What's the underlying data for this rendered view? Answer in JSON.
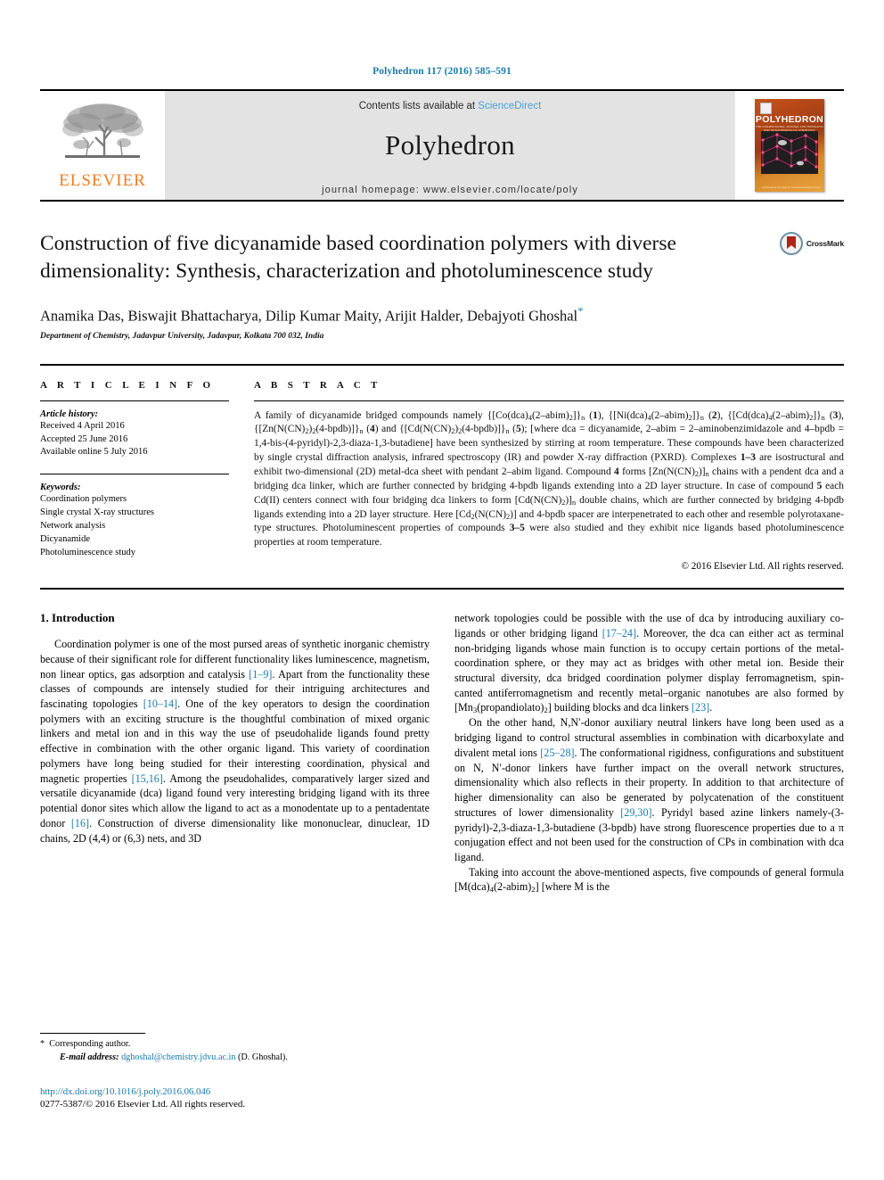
{
  "running_head": "Polyhedron 117 (2016) 585–591",
  "masthead": {
    "contents_prefix": "Contents lists available at ",
    "sciencedirect": "ScienceDirect",
    "journal_name": "Polyhedron",
    "homepage": "journal homepage: www.elsevier.com/locate/poly",
    "publisher_logo_text": "ELSEVIER",
    "cover": {
      "title": "POLYHEDRON",
      "subtitle": "THE INTERNATIONAL JOURNAL FOR INORGANIC AND ORGANOMETALLIC CHEMISTRY",
      "footer": "AVAILABLE ONLINE AT\nSCIENCEDIRECT.COM"
    }
  },
  "article": {
    "title": "Construction of five dicyanamide based coordination polymers with diverse dimensionality: Synthesis, characterization and photoluminescence study",
    "authors": "Anamika Das, Biswajit Bhattacharya, Dilip Kumar Maity, Arijit Halder, Debajyoti Ghoshal",
    "corresponding_marker": "*",
    "affiliation": "Department of Chemistry, Jadavpur University, Jadavpur, Kolkata 700 032, India",
    "crossmark_label": "CrossMark"
  },
  "article_info": {
    "heading": "A R T I C L E    I N F O",
    "history_label": "Article history:",
    "history": [
      "Received 4 April 2016",
      "Accepted 25 June 2016",
      "Available online 5 July 2016"
    ],
    "keywords_label": "Keywords:",
    "keywords": [
      "Coordination polymers",
      "Single crystal X-ray structures",
      "Network analysis",
      "Dicyanamide",
      "Photoluminescence study"
    ]
  },
  "abstract": {
    "heading": "A B S T R A C T",
    "paragraph_html": "A family of dicyanamide bridged compounds namely {[Co(dca)<sub>4</sub>(2–abim)<sub>2</sub>]}<sub>n</sub> (<b>1</b>), {[Ni(dca)<sub>4</sub>(2–abim)<sub>2</sub>]}<sub>n</sub> (<b>2</b>), {[Cd(dca)<sub>4</sub>(2–abim)<sub>2</sub>]}<sub>n</sub> (<b>3</b>), {[Zn(N(CN)<sub>2</sub>)<sub>2</sub>(4-bpdb)]}<sub>n</sub> (<b>4</b>) and {[Cd(N(CN)<sub>2</sub>)<sub>2</sub>(4-bpdb)]}<sub>n</sub> (<b>5</b>); [where dca = dicyanamide, 2–abim = 2–aminobenzimidazole and 4–bpdb = 1,4-bis-(4-pyridyl)-2,3-diaza-1,3-butadiene] have been synthesized by stirring at room temperature. These compounds have been characterized by single crystal diffraction analysis, infrared spectroscopy (IR) and powder X-ray diffraction (PXRD). Complexes <b>1–3</b> are isostructural and exhibit two-dimensional (2D) metal-dca sheet with pendant 2–abim ligand. Compound <b>4</b> forms [Zn(N(CN)<sub>2</sub>)]<sub>n</sub> chains with a pendent dca and a bridging dca linker, which are further connected by bridging 4-bpdb ligands extending into a 2D layer structure. In case of compound <b>5</b> each Cd(II) centers connect with four bridging dca linkers to form [Cd(N(CN)<sub>2</sub>)]<sub>n</sub> double chains, which are further connected by bridging 4-bpdb ligands extending into a 2D layer structure. Here [Cd<sub>2</sub>(N(CN)<sub>2</sub>)] and 4-bpdb spacer are interpenetrated to each other and resemble polyrotaxane-type structures. Photoluminescent properties of compounds <b>3–5</b> were also studied and they exhibit nice ligands based photoluminescence properties at room temperature.",
    "copyright": "© 2016 Elsevier Ltd. All rights reserved."
  },
  "introduction": {
    "heading": "1. Introduction",
    "left_paragraph_1_html": "Coordination polymer is one of the most pursed areas of synthetic inorganic chemistry because of their significant role for different functionality likes luminescence, magnetism, non linear optics, gas adsorption and catalysis <span class=\"ref\">[1–9]</span>. Apart from the functionality these classes of compounds are intensely studied for their intriguing architectures and fascinating topologies <span class=\"ref\">[10–14]</span>. One of the key operators to design the coordination polymers with an exciting structure is the thoughtful combination of mixed organic linkers and metal ion and in this way the use of pseudohalide ligands found pretty effective in combination with the other organic ligand. This variety of coordination polymers have long being studied for their interesting coordination, physical and magnetic properties <span class=\"ref\">[15,16]</span>. Among the pseudohalides, comparatively larger sized and versatile dicyanamide (dca) ligand found very interesting bridging ligand with its three potential donor sites which allow the ligand to act as a monodentate up to a pentadentate donor <span class=\"ref\">[16]</span>. Construction of diverse dimensionality like mononuclear, dinuclear, 1D chains, 2D (4,4) or (6,3) nets, and 3D",
    "right_paragraph_1_html": "network topologies could be possible with the use of dca by introducing auxiliary co-ligands or other bridging ligand <span class=\"ref\">[17–24]</span>. Moreover, the dca can either act as terminal non-bridging ligands whose main function is to occupy certain portions of the metal-coordination sphere, or they may act as bridges with other metal ion. Beside their structural diversity, dca bridged coordination polymer display ferromagnetism, spin-canted antiferromagnetism and recently metal–organic nanotubes are also formed by [Mn<sub>3</sub>(propandiolato)<sub>2</sub>] building blocks and dca linkers <span class=\"ref\">[23]</span>.",
    "right_paragraph_2_html": "On the other hand, N,N′-donor auxiliary neutral linkers have long been used as a bridging ligand to control structural assemblies in combination with dicarboxylate and divalent metal ions <span class=\"ref\">[25–28]</span>. The conformational rigidness, configurations and substituent on N, N′-donor linkers have further impact on the overall network structures, dimensionality which also reflects in their property. In addition to that architecture of higher dimensionality can also be generated by polycatenation of the constituent structures of lower dimensionality <span class=\"ref\">[29,30]</span>. Pyridyl based azine linkers namely-(3-pyridyl)-2,3-diaza-1,3-butadiene (3-bpdb) have strong fluorescence properties due to a π conjugation effect and not been used for the construction of CPs in combination with dca ligand.",
    "right_paragraph_3_html": "Taking into account the above-mentioned aspects, five compounds of general formula [M(dca)<sub>4</sub>(2-abim)<sub>2</sub>] [where M is the"
  },
  "footnote": {
    "corresponding_author": "Corresponding author.",
    "email_label": "E-mail address:",
    "email": "dghoshal@chemistry.jdvu.ac.in",
    "email_owner": "(D. Ghoshal)."
  },
  "footer": {
    "doi": "http://dx.doi.org/10.1016/j.poly.2016.06.046",
    "issn_copyright": "0277-5387/© 2016 Elsevier Ltd. All rights reserved."
  },
  "colors": {
    "link": "#1a7aab",
    "sciencedirect": "#4a9fd4",
    "elsevier_orange": "#f47b20",
    "masthead_bg": "#e3e3e3"
  }
}
